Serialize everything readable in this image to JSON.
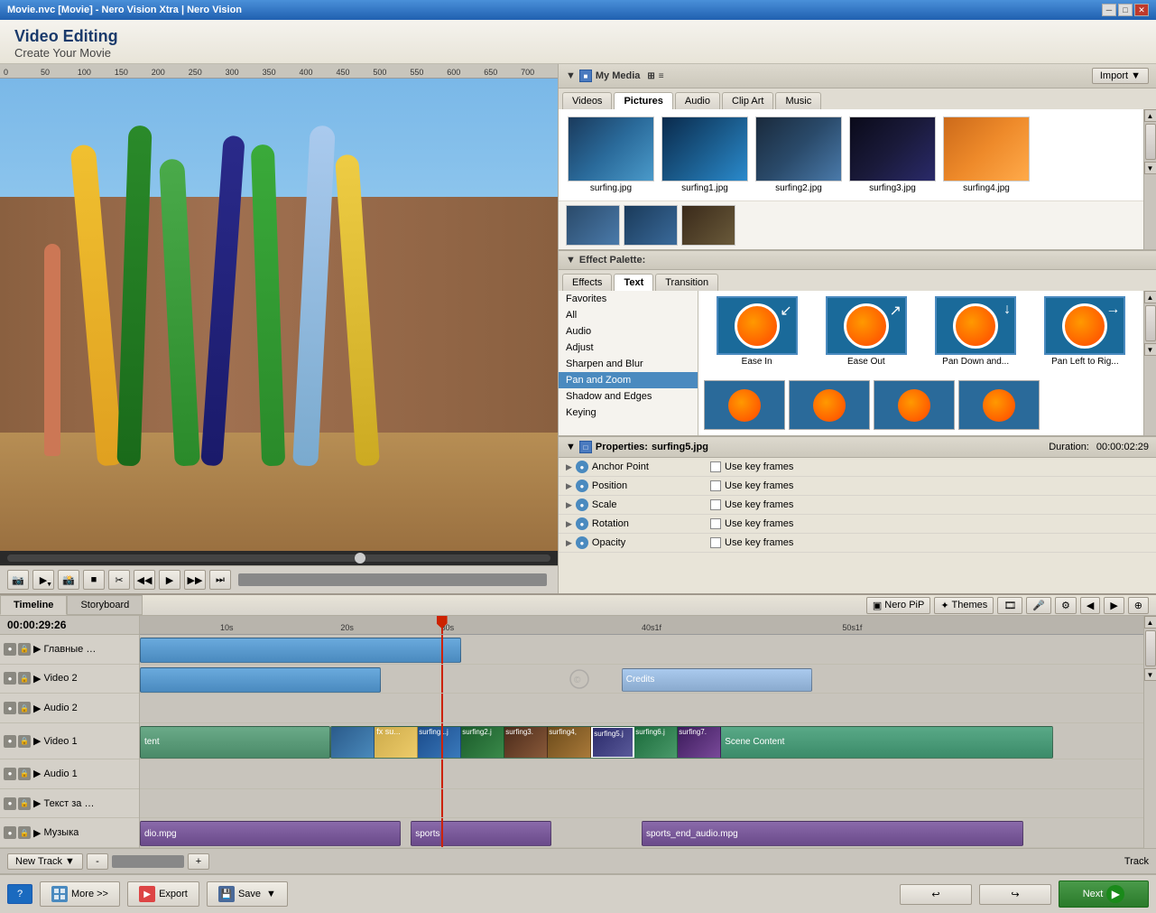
{
  "app": {
    "title": "Movie.nvc [Movie] - Nero Vision Xtra | Nero Vision"
  },
  "header": {
    "title": "Video Editing",
    "subtitle": "Create Your Movie"
  },
  "my_media": {
    "title": "My Media",
    "import_label": "Import ▼",
    "tabs": [
      "Videos",
      "Pictures",
      "Audio",
      "Clip Art",
      "Music"
    ],
    "active_tab": "Pictures",
    "thumbnails": [
      {
        "label": "surfing.jpg",
        "class": "surf-img-1"
      },
      {
        "label": "surfing1.jpg",
        "class": "surf-img-2"
      },
      {
        "label": "surfing2.jpg",
        "class": "surf-img-3"
      },
      {
        "label": "surfing3.jpg",
        "class": "surf-img-4"
      },
      {
        "label": "surfing4.jpg",
        "class": "surf-img-5"
      }
    ]
  },
  "effect_palette": {
    "title": "Effect Palette:",
    "tabs": [
      "Effects",
      "Text",
      "Transition"
    ],
    "active_tab": "Effects",
    "categories": [
      {
        "label": "Favorites"
      },
      {
        "label": "All"
      },
      {
        "label": "Audio"
      },
      {
        "label": "Adjust"
      },
      {
        "label": "Sharpen and Blur"
      },
      {
        "label": "Pan and Zoom",
        "selected": true
      },
      {
        "label": "Shadow and Edges"
      },
      {
        "label": "Keying"
      }
    ],
    "effects": [
      {
        "label": "Ease In"
      },
      {
        "label": "Ease Out"
      },
      {
        "label": "Pan Down and..."
      },
      {
        "label": "Pan Left to Rig..."
      }
    ]
  },
  "properties": {
    "title": "Properties:",
    "filename": "surfing5.jpg",
    "duration_label": "Duration:",
    "duration": "00:00:02:29",
    "rows": [
      {
        "label": "Anchor Point",
        "key_frames": false
      },
      {
        "label": "Position",
        "key_frames": false
      },
      {
        "label": "Scale",
        "key_frames": false
      },
      {
        "label": "Rotation",
        "key_frames": false
      },
      {
        "label": "Opacity",
        "key_frames": false
      }
    ],
    "use_key_frames_label": "Use key frames"
  },
  "timeline": {
    "tabs": [
      "Timeline",
      "Storyboard"
    ],
    "active_tab": "Timeline",
    "current_time": "00:00:29:26",
    "tools": [
      "Nero PiP",
      "Themes"
    ],
    "time_marks": [
      "10s",
      "20s",
      "30s",
      "40s1f",
      "50s1f"
    ],
    "playhead_position_pct": 30,
    "tracks": [
      {
        "name": "Главные эф...",
        "type": "effects",
        "height": "normal"
      },
      {
        "name": "Video 2",
        "type": "video",
        "height": "normal"
      },
      {
        "name": "Audio 2",
        "type": "audio",
        "height": "normal"
      },
      {
        "name": "Video 1",
        "type": "video",
        "height": "tall"
      },
      {
        "name": "Audio 1",
        "type": "audio",
        "height": "normal"
      },
      {
        "name": "Текст за ка...",
        "type": "text",
        "height": "normal"
      },
      {
        "name": "Музыка",
        "type": "music",
        "height": "normal"
      }
    ],
    "clips": [
      {
        "track": 1,
        "left_pct": 0,
        "width_pct": 30,
        "label": "",
        "type": "blue"
      },
      {
        "track": 2,
        "left_pct": 0,
        "width_pct": 23,
        "label": "",
        "type": "blue"
      },
      {
        "track": 2,
        "left_pct": 48,
        "width_pct": 18,
        "label": "Credits",
        "type": "credits"
      },
      {
        "track": 4,
        "left_pct": 20,
        "width_pct": 70,
        "label": "Scene Content",
        "type": "video"
      },
      {
        "track": 7,
        "left_pct": 0,
        "width_pct": 25,
        "label": "dio.mpg",
        "type": "audio"
      },
      {
        "track": 7,
        "left_pct": 26,
        "width_pct": 15,
        "label": "sports",
        "type": "audio"
      },
      {
        "track": 7,
        "left_pct": 50,
        "width_pct": 35,
        "label": "sports_end_audio.mpg",
        "type": "audio"
      }
    ]
  },
  "bottom_bar": {
    "help_label": "?",
    "more_label": "More >>",
    "export_label": "Export",
    "save_label": "Save",
    "next_label": "Next"
  },
  "new_track": {
    "label": "New Track ▼",
    "track_label": "Track"
  }
}
